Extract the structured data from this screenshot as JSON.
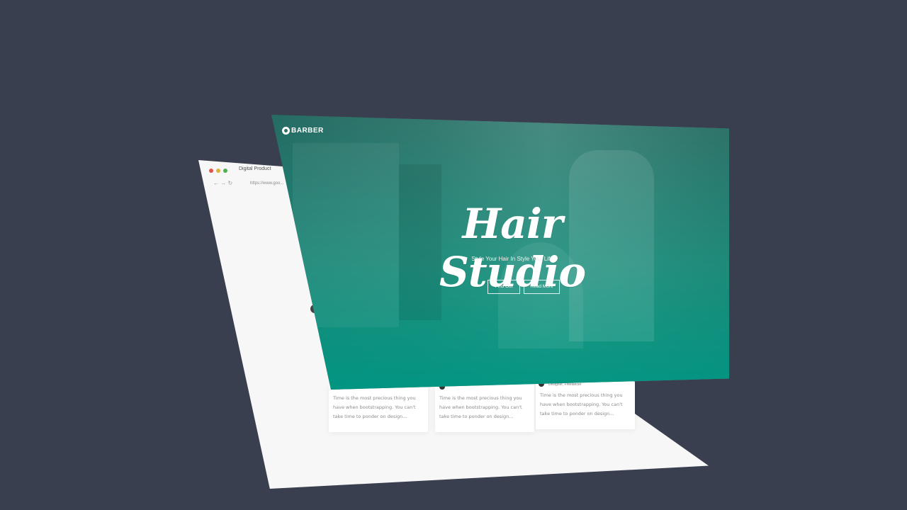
{
  "browser": {
    "tab_title": "Digital Product",
    "url": "https://www.goo...",
    "nav_icons": "← → ↻"
  },
  "hero": {
    "brand": "BARBER",
    "title": "Hair Studio",
    "subtitle": "Style Your Hair In Style Your Life",
    "buttons": [
      {
        "label": "Find Out"
      },
      {
        "label": "Read More"
      }
    ]
  },
  "cards": [
    {
      "author": "",
      "text": "Time is the most precious thing you have when bootstrapping. You can't take time to ponder on design..."
    },
    {
      "author": "",
      "text": "Time is the most precious thing you have when bootstrapping. You can't take time to ponder on design..."
    },
    {
      "author": "Designer, Freelancer",
      "text": "Time is the most precious thing you have when bootstrapping. You can't take time to ponder on design..."
    }
  ],
  "colors": {
    "background": "#3a3f4f",
    "hero_teal": "#00968a",
    "browser_bg": "#f7f7f7"
  }
}
